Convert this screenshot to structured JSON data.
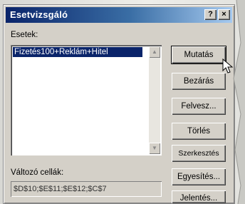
{
  "window": {
    "title": "Esetvizsgáló",
    "help_glyph": "?",
    "close_glyph": "×"
  },
  "scenarios": {
    "label": "Esetek:",
    "items": [
      "Fizetés100+Reklám+Hitel"
    ]
  },
  "changing_cells": {
    "label": "Változó cellák:",
    "value": "$D$10;$E$11;$E$12;$C$7"
  },
  "buttons": {
    "show": "Mutatás",
    "close": "Bezárás",
    "add": "Felvesz...",
    "delete": "Törlés",
    "edit": "Szerkesztés",
    "merge": "Egyesítés...",
    "summary": "Jelentés..."
  }
}
